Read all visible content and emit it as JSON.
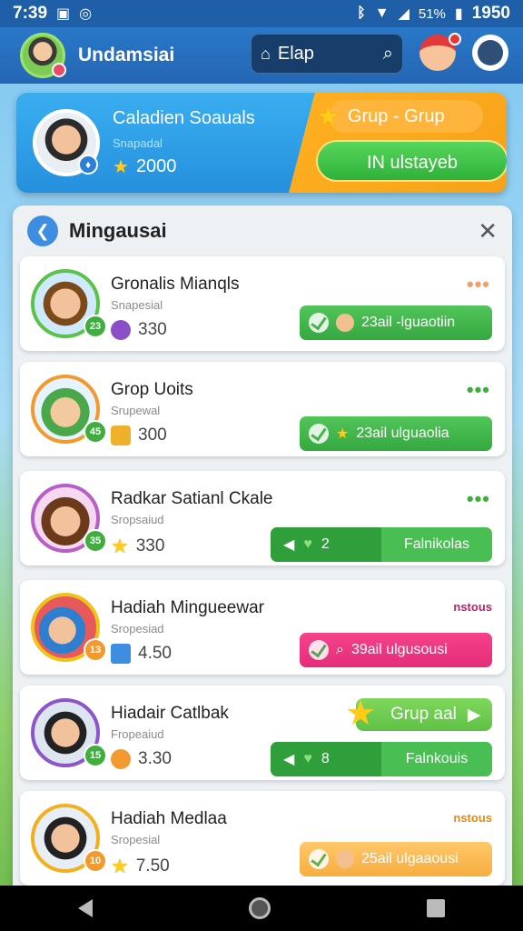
{
  "status_bar": {
    "time": "7:39",
    "battery_pct": "51%",
    "battery_time": "1950"
  },
  "app_bar": {
    "title": "Undamsiai",
    "search_text": "Elap"
  },
  "top_card": {
    "name": "Caladien Soauals",
    "subtitle": "Snapadal",
    "points": "2000",
    "group_label": "Grup - Grup",
    "cta_label": "IN ulstayeb"
  },
  "panel": {
    "title": "Mingausai",
    "rows": [
      {
        "name": "Gronalis Mianqls",
        "sub": "Snapesial",
        "score": "330",
        "level": "23",
        "more": "•••",
        "action": "23ail -lguaotiin",
        "colors": {
          "ring": "#5cc24a",
          "icon": "#8a4fc7",
          "more": "#f0a06a"
        }
      },
      {
        "name": "Grop Uoits",
        "sub": "Srupewal",
        "score": "300",
        "level": "45",
        "more": "•••",
        "action": "23ail ulguaolia",
        "colors": {
          "ring": "#f29a2e",
          "icon": "#f0b12a",
          "more": "#3fae3f"
        }
      },
      {
        "name": "Radkar Satianl Ckale",
        "sub": "Sropsaiud",
        "score": "330",
        "level": "35",
        "more": "•••",
        "seg_left": "2",
        "seg_right": "Falnikolas",
        "colors": {
          "ring": "#b65fc7",
          "icon": "#ffcc1a",
          "more": "#3fae3f"
        }
      },
      {
        "name": "Hadiah Mingueewar",
        "sub": "Sropesiad",
        "score": "4.50",
        "level": "13",
        "tag": "nstous",
        "action": "39ail ulgusousi",
        "colors": {
          "ring": "#f0c31a",
          "icon": "#3d8de0",
          "tag": "#b0246a"
        }
      },
      {
        "name": "Hiadair Catlbak",
        "sub": "Fropeaiud",
        "score": "3.30",
        "level": "15",
        "grup": "Grup aal",
        "seg_left": "8",
        "seg_right": "Falnkouis",
        "colors": {
          "ring": "#8c55c9",
          "icon": "#f29a2e"
        }
      },
      {
        "name": "Hadiah Medlaa",
        "sub": "Sropesial",
        "score": "7.50",
        "level": "10",
        "tag": "nstous",
        "action": "25ail ulgaaousi",
        "colors": {
          "ring": "#f2b01e",
          "icon": "#ffcc1a",
          "tag": "#e08a1a"
        }
      }
    ]
  }
}
